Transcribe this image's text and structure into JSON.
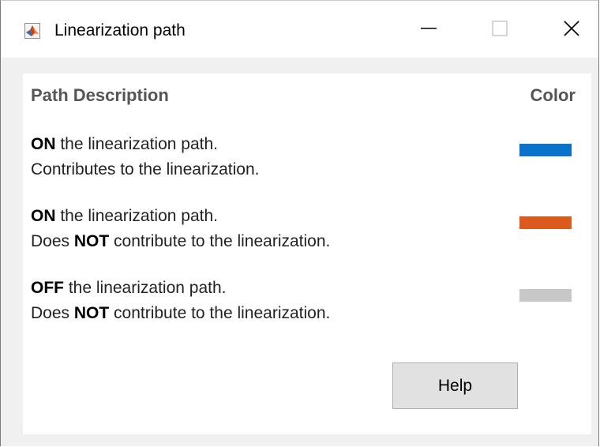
{
  "window": {
    "title": "Linearization path",
    "icon": "matlab-logo-icon",
    "controls": [
      "minimize-icon",
      "maximize-icon",
      "close-icon"
    ]
  },
  "header": {
    "description": "Path Description",
    "color": "Color"
  },
  "rows": [
    {
      "keyword": "ON",
      "line1_rest": " the linearization path.",
      "line2_prefix": "Contributes to the linearization.",
      "line2_bold": "",
      "line2_rest": "",
      "color": "#0a72c8"
    },
    {
      "keyword": "ON",
      "line1_rest": " the linearization path.",
      "line2_prefix": "Does ",
      "line2_bold": "NOT",
      "line2_rest": " contribute to the linearization.",
      "color": "#dc5a1e"
    },
    {
      "keyword": "OFF",
      "line1_rest": " the linearization path.",
      "line2_prefix": "Does ",
      "line2_bold": "NOT",
      "line2_rest": " contribute to the linearization.",
      "color": "#c8c8c8"
    }
  ],
  "buttons": {
    "help": "Help"
  }
}
